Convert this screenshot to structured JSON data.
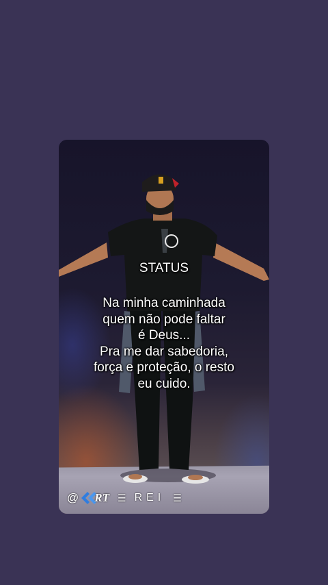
{
  "status_post": {
    "title": "STATUS",
    "lines": [
      "Na minha caminhada",
      "quem não pode faltar",
      "é Deus...",
      "Pra me dar sabedoria,",
      "força e proteção, o resto",
      "eu cuido."
    ]
  },
  "footer": {
    "at": "@",
    "logo_icon": "double-chevron-left-icon",
    "logo_text": "RT",
    "bars_left": "☰",
    "name": "REI",
    "bars_right": "☰"
  },
  "colors": {
    "background": "#3a3355",
    "text": "#ffffff",
    "logo_blue": "#2f7de0"
  }
}
